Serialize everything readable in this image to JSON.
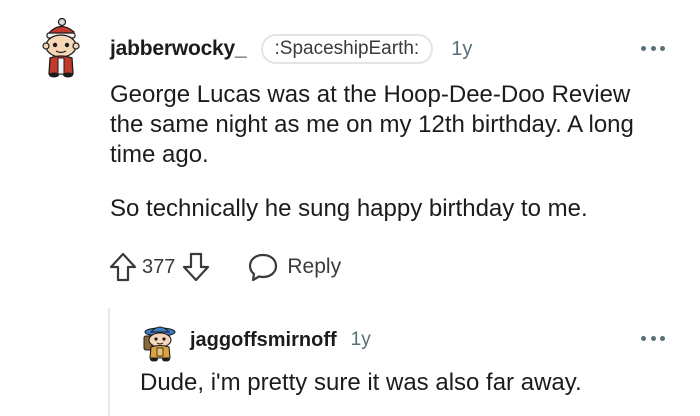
{
  "comment": {
    "username": "jabberwocky_",
    "flair": ":SpaceshipEarth:",
    "age": "1y",
    "paragraphs": [
      "George Lucas was at the Hoop-Dee-Doo Review the same night as me on my 12th birthday. A long time ago.",
      "So technically he sung happy birthday to me."
    ],
    "score": "377",
    "reply_label": "Reply",
    "icons": {
      "avatar": "snoo-avatar-santa-hat",
      "upvote": "arrow-up-outline-icon",
      "downvote": "arrow-down-outline-icon",
      "reply": "speech-bubble-icon",
      "more": "overflow-dots-icon"
    }
  },
  "reply": {
    "username": "jaggoffsmirnoff",
    "age": "1y",
    "text": "Dude, i'm pretty sure it was also far away.",
    "icons": {
      "avatar": "snoo-avatar-explorer",
      "more": "overflow-dots-icon"
    }
  },
  "colors": {
    "text": "#1c1c1c",
    "meta": "#576f76",
    "flair_border": "#e2e4e6",
    "thread_line": "#e5e7e9",
    "avatar_red": "#c0392b"
  }
}
